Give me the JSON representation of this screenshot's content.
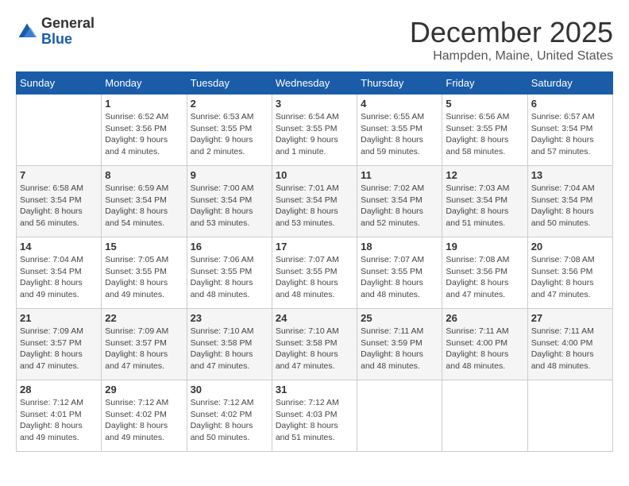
{
  "logo": {
    "general": "General",
    "blue": "Blue"
  },
  "title": "December 2025",
  "subtitle": "Hampden, Maine, United States",
  "weekdays": [
    "Sunday",
    "Monday",
    "Tuesday",
    "Wednesday",
    "Thursday",
    "Friday",
    "Saturday"
  ],
  "weeks": [
    [
      {
        "day": "",
        "info": ""
      },
      {
        "day": "1",
        "info": "Sunrise: 6:52 AM\nSunset: 3:56 PM\nDaylight: 9 hours\nand 4 minutes."
      },
      {
        "day": "2",
        "info": "Sunrise: 6:53 AM\nSunset: 3:55 PM\nDaylight: 9 hours\nand 2 minutes."
      },
      {
        "day": "3",
        "info": "Sunrise: 6:54 AM\nSunset: 3:55 PM\nDaylight: 9 hours\nand 1 minute."
      },
      {
        "day": "4",
        "info": "Sunrise: 6:55 AM\nSunset: 3:55 PM\nDaylight: 8 hours\nand 59 minutes."
      },
      {
        "day": "5",
        "info": "Sunrise: 6:56 AM\nSunset: 3:55 PM\nDaylight: 8 hours\nand 58 minutes."
      },
      {
        "day": "6",
        "info": "Sunrise: 6:57 AM\nSunset: 3:54 PM\nDaylight: 8 hours\nand 57 minutes."
      }
    ],
    [
      {
        "day": "7",
        "info": "Sunrise: 6:58 AM\nSunset: 3:54 PM\nDaylight: 8 hours\nand 56 minutes."
      },
      {
        "day": "8",
        "info": "Sunrise: 6:59 AM\nSunset: 3:54 PM\nDaylight: 8 hours\nand 54 minutes."
      },
      {
        "day": "9",
        "info": "Sunrise: 7:00 AM\nSunset: 3:54 PM\nDaylight: 8 hours\nand 53 minutes."
      },
      {
        "day": "10",
        "info": "Sunrise: 7:01 AM\nSunset: 3:54 PM\nDaylight: 8 hours\nand 53 minutes."
      },
      {
        "day": "11",
        "info": "Sunrise: 7:02 AM\nSunset: 3:54 PM\nDaylight: 8 hours\nand 52 minutes."
      },
      {
        "day": "12",
        "info": "Sunrise: 7:03 AM\nSunset: 3:54 PM\nDaylight: 8 hours\nand 51 minutes."
      },
      {
        "day": "13",
        "info": "Sunrise: 7:04 AM\nSunset: 3:54 PM\nDaylight: 8 hours\nand 50 minutes."
      }
    ],
    [
      {
        "day": "14",
        "info": "Sunrise: 7:04 AM\nSunset: 3:54 PM\nDaylight: 8 hours\nand 49 minutes."
      },
      {
        "day": "15",
        "info": "Sunrise: 7:05 AM\nSunset: 3:55 PM\nDaylight: 8 hours\nand 49 minutes."
      },
      {
        "day": "16",
        "info": "Sunrise: 7:06 AM\nSunset: 3:55 PM\nDaylight: 8 hours\nand 48 minutes."
      },
      {
        "day": "17",
        "info": "Sunrise: 7:07 AM\nSunset: 3:55 PM\nDaylight: 8 hours\nand 48 minutes."
      },
      {
        "day": "18",
        "info": "Sunrise: 7:07 AM\nSunset: 3:55 PM\nDaylight: 8 hours\nand 48 minutes."
      },
      {
        "day": "19",
        "info": "Sunrise: 7:08 AM\nSunset: 3:56 PM\nDaylight: 8 hours\nand 47 minutes."
      },
      {
        "day": "20",
        "info": "Sunrise: 7:08 AM\nSunset: 3:56 PM\nDaylight: 8 hours\nand 47 minutes."
      }
    ],
    [
      {
        "day": "21",
        "info": "Sunrise: 7:09 AM\nSunset: 3:57 PM\nDaylight: 8 hours\nand 47 minutes."
      },
      {
        "day": "22",
        "info": "Sunrise: 7:09 AM\nSunset: 3:57 PM\nDaylight: 8 hours\nand 47 minutes."
      },
      {
        "day": "23",
        "info": "Sunrise: 7:10 AM\nSunset: 3:58 PM\nDaylight: 8 hours\nand 47 minutes."
      },
      {
        "day": "24",
        "info": "Sunrise: 7:10 AM\nSunset: 3:58 PM\nDaylight: 8 hours\nand 47 minutes."
      },
      {
        "day": "25",
        "info": "Sunrise: 7:11 AM\nSunset: 3:59 PM\nDaylight: 8 hours\nand 48 minutes."
      },
      {
        "day": "26",
        "info": "Sunrise: 7:11 AM\nSunset: 4:00 PM\nDaylight: 8 hours\nand 48 minutes."
      },
      {
        "day": "27",
        "info": "Sunrise: 7:11 AM\nSunset: 4:00 PM\nDaylight: 8 hours\nand 48 minutes."
      }
    ],
    [
      {
        "day": "28",
        "info": "Sunrise: 7:12 AM\nSunset: 4:01 PM\nDaylight: 8 hours\nand 49 minutes."
      },
      {
        "day": "29",
        "info": "Sunrise: 7:12 AM\nSunset: 4:02 PM\nDaylight: 8 hours\nand 49 minutes."
      },
      {
        "day": "30",
        "info": "Sunrise: 7:12 AM\nSunset: 4:02 PM\nDaylight: 8 hours\nand 50 minutes."
      },
      {
        "day": "31",
        "info": "Sunrise: 7:12 AM\nSunset: 4:03 PM\nDaylight: 8 hours\nand 51 minutes."
      },
      {
        "day": "",
        "info": ""
      },
      {
        "day": "",
        "info": ""
      },
      {
        "day": "",
        "info": ""
      }
    ]
  ]
}
